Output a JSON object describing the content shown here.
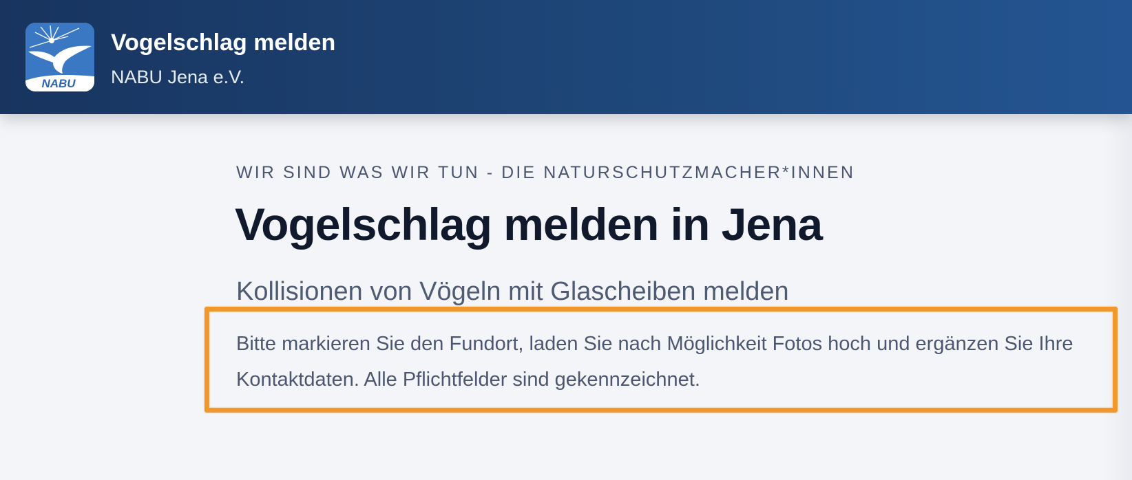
{
  "header": {
    "title": "Vogelschlag melden",
    "subtitle": "NABU Jena e.V.",
    "logo_text": "NABU",
    "colors": {
      "bar": "#1e4779",
      "logo_background": "#3b78c4"
    },
    "logo_icon": "bird-collision-logo-icon"
  },
  "main": {
    "eyebrow": "WIR SIND WAS WIR TUN - DIE NATURSCHUTZMACHER*INNEN",
    "headline": "Vogelschlag melden in Jena",
    "subheadline": "Kollisionen von Vögeln mit Glascheiben melden",
    "intro": "Bitte markieren Sie den Fundort, laden Sie nach Möglichkeit Fotos hoch und ergänzen Sie Ihre Kontaktdaten. Alle Pflichtfelder sind gekennzeichnet."
  },
  "annotation": {
    "color": "#f0982e"
  }
}
